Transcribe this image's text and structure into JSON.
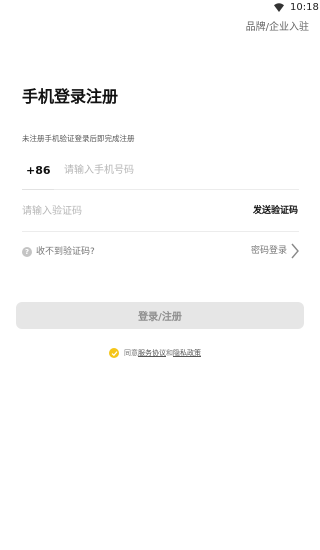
{
  "status_bar": {
    "time": "10:18"
  },
  "header": {
    "brand_link": "品牌/企业入驻"
  },
  "title": "手机登录注册",
  "subtitle": "未注册手机验证登录后即完成注册",
  "phone": {
    "country_code": "+86",
    "placeholder": "请输入手机号码"
  },
  "code": {
    "placeholder": "请输入验证码",
    "send_label": "发送验证码"
  },
  "help": {
    "icon_glyph": "?",
    "label": "收不到验证码?"
  },
  "password_login": {
    "label": "密码登录"
  },
  "login_button": {
    "label": "登录/注册"
  },
  "agreement": {
    "prefix": "同意",
    "service_link": "服务协议",
    "and": "和",
    "privacy_link": "隐私政策"
  },
  "colors": {
    "accent": "#f5c518",
    "button_disabled_bg": "#e6e6e6",
    "button_disabled_text": "#8e8e8e"
  },
  "icons": [
    "wifi-icon",
    "help-icon",
    "chevron-right-icon",
    "check-icon"
  ]
}
